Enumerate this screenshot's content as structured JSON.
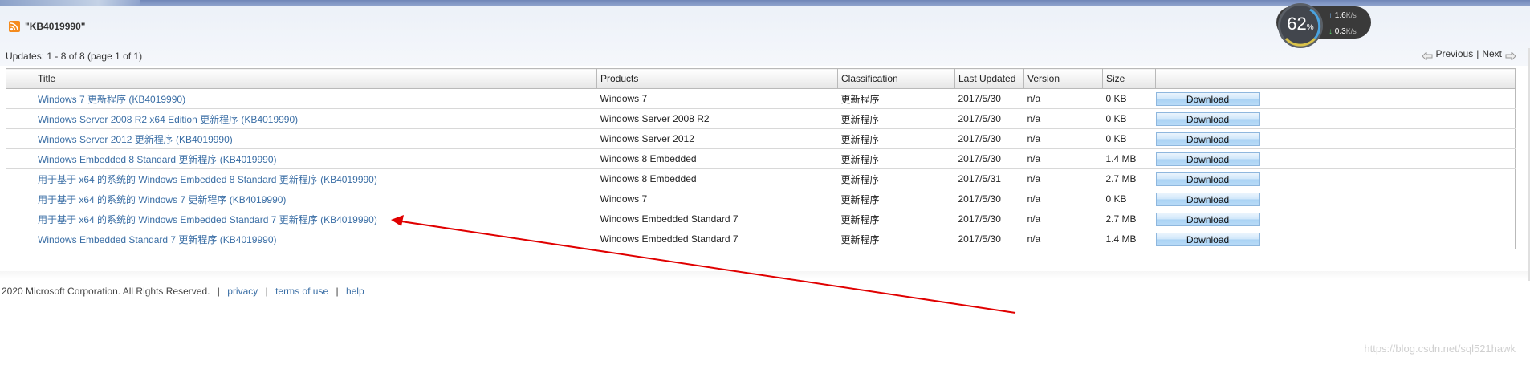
{
  "search": {
    "query_title": "\"KB4019990\""
  },
  "summary": {
    "updates_count": "Updates: 1 - 8 of 8 (page 1 of 1)"
  },
  "pager": {
    "previous": "Previous",
    "separator": "|",
    "next": "Next"
  },
  "network_widget": {
    "percent": "62",
    "percent_sign": "%",
    "up_value": "1.6",
    "up_unit": "K/s",
    "down_value": "0.3",
    "down_unit": "K/s"
  },
  "table": {
    "headers": {
      "title": "Title",
      "products": "Products",
      "classification": "Classification",
      "last_updated": "Last Updated",
      "version": "Version",
      "size": "Size"
    },
    "rows": [
      {
        "title": "Windows 7 更新程序 (KB4019990)",
        "products": "Windows 7",
        "classification": "更新程序",
        "last_updated": "2017/5/30",
        "version": "n/a",
        "size": "0 KB",
        "download": "Download"
      },
      {
        "title": "Windows Server 2008 R2 x64 Edition 更新程序 (KB4019990)",
        "products": "Windows Server 2008 R2",
        "classification": "更新程序",
        "last_updated": "2017/5/30",
        "version": "n/a",
        "size": "0 KB",
        "download": "Download"
      },
      {
        "title": "Windows Server 2012 更新程序 (KB4019990)",
        "products": "Windows Server 2012",
        "classification": "更新程序",
        "last_updated": "2017/5/30",
        "version": "n/a",
        "size": "0 KB",
        "download": "Download"
      },
      {
        "title": "Windows Embedded 8 Standard 更新程序 (KB4019990)",
        "products": "Windows 8 Embedded",
        "classification": "更新程序",
        "last_updated": "2017/5/30",
        "version": "n/a",
        "size": "1.4 MB",
        "download": "Download"
      },
      {
        "title": "用于基于 x64 的系统的 Windows Embedded 8 Standard 更新程序 (KB4019990)",
        "products": "Windows 8 Embedded",
        "classification": "更新程序",
        "last_updated": "2017/5/31",
        "version": "n/a",
        "size": "2.7 MB",
        "download": "Download"
      },
      {
        "title": "用于基于 x64 的系统的 Windows 7 更新程序 (KB4019990)",
        "products": "Windows 7",
        "classification": "更新程序",
        "last_updated": "2017/5/30",
        "version": "n/a",
        "size": "0 KB",
        "download": "Download"
      },
      {
        "title": "用于基于 x64 的系统的 Windows Embedded Standard 7 更新程序 (KB4019990)",
        "products": "Windows Embedded Standard 7",
        "classification": "更新程序",
        "last_updated": "2017/5/30",
        "version": "n/a",
        "size": "2.7 MB",
        "download": "Download"
      },
      {
        "title": "Windows Embedded Standard 7 更新程序 (KB4019990)",
        "products": "Windows Embedded Standard 7",
        "classification": "更新程序",
        "last_updated": "2017/5/30",
        "version": "n/a",
        "size": "1.4 MB",
        "download": "Download"
      }
    ]
  },
  "footer": {
    "copyright": "2020 Microsoft Corporation. All Rights Reserved.",
    "privacy": "privacy",
    "terms": "terms of use",
    "help": "help",
    "separator": "|"
  },
  "watermark": "https://blog.csdn.net/sql521hawk",
  "colors": {
    "link": "#3a6ea5",
    "annotation_arrow": "#e00000",
    "rss": "#f48b1e"
  },
  "icons": {
    "feed": "rss-icon",
    "previous": "previous-arrow-icon",
    "next": "next-arrow-icon",
    "upload": "upload-arrow-icon",
    "download": "download-arrow-icon"
  }
}
